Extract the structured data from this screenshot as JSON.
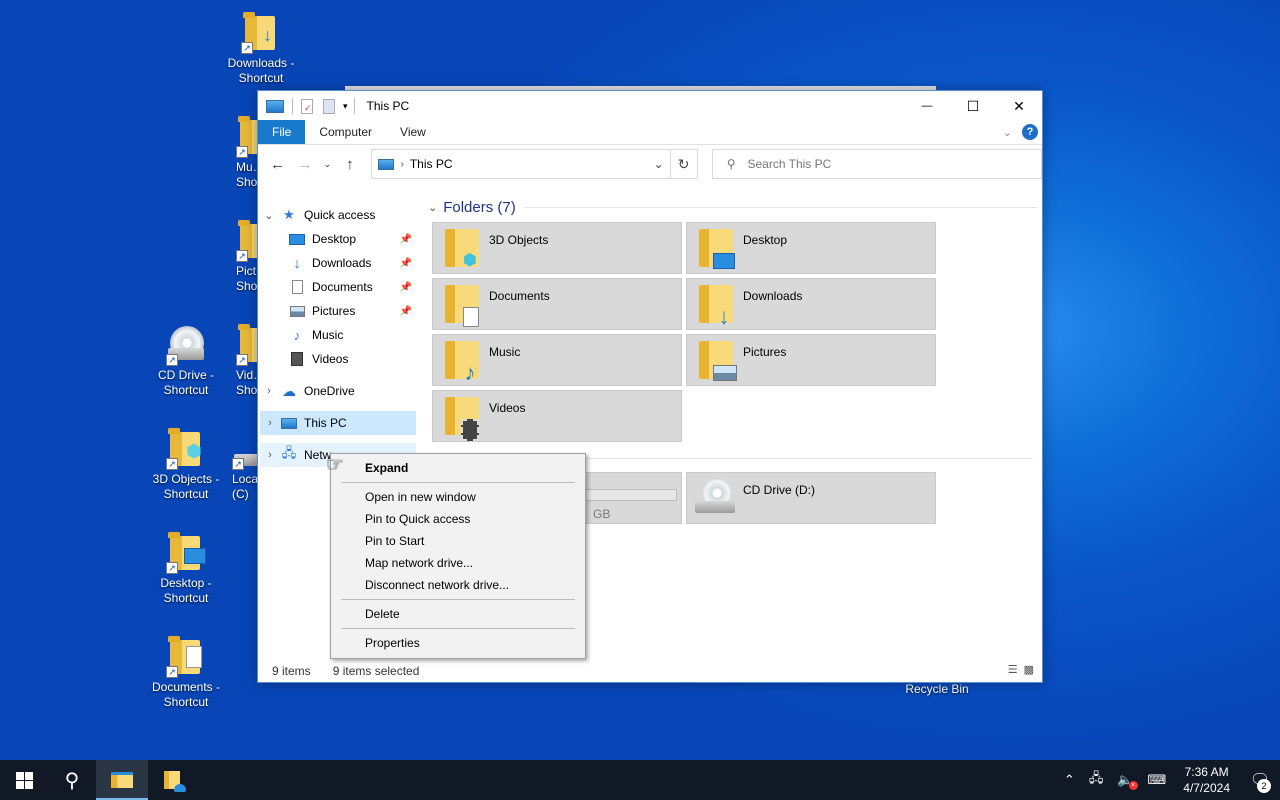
{
  "desktop": {
    "icons": [
      {
        "label": "Downloads - Shortcut"
      },
      {
        "label": "Mu… Shor…"
      },
      {
        "label": "Pict… Shor…"
      },
      {
        "label": "CD Drive - Shortcut"
      },
      {
        "label": "Vid… Shor…"
      },
      {
        "label": "3D Objects - Shortcut"
      },
      {
        "label": "Loca… (C)"
      },
      {
        "label": "Desktop - Shortcut"
      },
      {
        "label": "Documents - Shortcut"
      }
    ],
    "recycle_bin": "Recycle Bin"
  },
  "window": {
    "title": "This PC",
    "controls": {
      "minimize": "—",
      "maximize": "☐",
      "close": "✕"
    },
    "ribbon_tabs": [
      "File",
      "Computer",
      "View"
    ],
    "address": "This PC",
    "search_placeholder": "Search This PC",
    "nav": {
      "quick_access": "Quick access",
      "items": [
        {
          "label": "Desktop",
          "icon": "desktop-icon",
          "pinned": true
        },
        {
          "label": "Downloads",
          "icon": "download-icon",
          "pinned": true
        },
        {
          "label": "Documents",
          "icon": "document-icon",
          "pinned": true
        },
        {
          "label": "Pictures",
          "icon": "pictures-icon",
          "pinned": true
        },
        {
          "label": "Music",
          "icon": "music-icon",
          "pinned": false
        },
        {
          "label": "Videos",
          "icon": "video-icon",
          "pinned": false
        }
      ],
      "onedrive": "OneDrive",
      "this_pc": "This PC",
      "network": "Netw"
    },
    "folders_header": "Folders (7)",
    "folders": [
      {
        "label": "3D Objects",
        "overlay": "cube-icon"
      },
      {
        "label": "Desktop",
        "overlay": "monitor-icon"
      },
      {
        "label": "Documents",
        "overlay": "document-icon"
      },
      {
        "label": "Downloads",
        "overlay": "download-arrow-icon"
      },
      {
        "label": "Music",
        "overlay": "music-note-icon"
      },
      {
        "label": "Pictures",
        "overlay": "landscape-icon"
      },
      {
        "label": "Videos",
        "overlay": "film-icon"
      }
    ],
    "drives": [
      {
        "label": "",
        "free": "GB"
      },
      {
        "label": "CD Drive (D:)"
      }
    ],
    "status": {
      "items": "9 items",
      "selected": "9 items selected"
    }
  },
  "context_menu": {
    "groups": [
      [
        "Expand"
      ],
      [
        "Open in new window",
        "Pin to Quick access",
        "Pin to Start",
        "Map network drive...",
        "Disconnect network drive..."
      ],
      [
        "Delete"
      ],
      [
        "Properties"
      ]
    ]
  },
  "taskbar": {
    "time": "7:36 AM",
    "date": "4/7/2024",
    "notification_count": "2"
  },
  "colors": {
    "accent": "#1979ca",
    "selection": "#cce8ff",
    "taskbar": "#101925"
  }
}
